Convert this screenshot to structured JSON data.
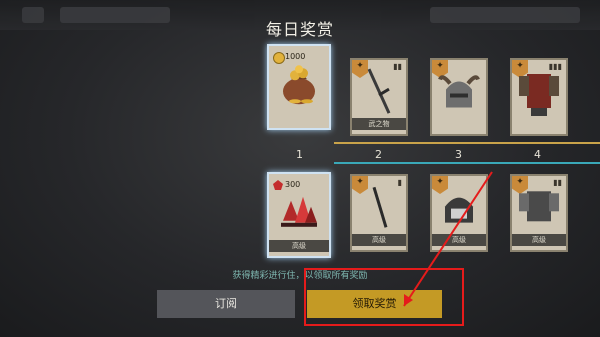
{
  "header": {
    "title": "每日奖赏"
  },
  "rewards": {
    "row1": [
      {
        "day": "1",
        "amount": "1000",
        "currency_icon": "coin-icon",
        "item_icon": "gold-sack-icon",
        "label": ""
      },
      {
        "day": "2",
        "amount": "",
        "item_icon": "sword-icon",
        "label": "武之物"
      },
      {
        "day": "3",
        "amount": "",
        "item_icon": "horned-helmet-icon",
        "label": ""
      },
      {
        "day": "4",
        "amount": "",
        "item_icon": "armor-icon",
        "label": ""
      }
    ],
    "row2": [
      {
        "amount": "300",
        "currency_icon": "gem-icon",
        "item_icon": "crystal-pile-icon",
        "label": "高级"
      },
      {
        "amount": "",
        "item_icon": "dagger-icon",
        "label": "高级"
      },
      {
        "amount": "",
        "item_icon": "helmet-icon",
        "label": "高级"
      },
      {
        "amount": "",
        "item_icon": "armor-icon",
        "label": "高级"
      }
    ]
  },
  "status_note": "获得精彩进行住，以领取所有奖励",
  "buttons": {
    "subscribe": "订阅",
    "claim": "领取奖赏"
  },
  "colors": {
    "accent_gold": "#c49a25",
    "annotation_red": "#e51b1b",
    "track_teal": "#3aa8b8"
  }
}
